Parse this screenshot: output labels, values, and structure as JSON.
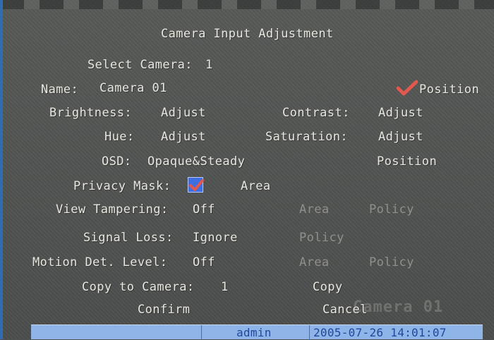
{
  "dialog": {
    "title": "Camera Input Adjustment",
    "select_camera_label": "Select Camera:",
    "select_camera_value": "1",
    "name_label": "Name:",
    "name_value": "Camera 01",
    "name_position_label": "Position",
    "brightness_label": "Brightness:",
    "brightness_action": "Adjust",
    "contrast_label": "Contrast:",
    "contrast_action": "Adjust",
    "hue_label": "Hue:",
    "hue_action": "Adjust",
    "saturation_label": "Saturation:",
    "saturation_action": "Adjust",
    "osd_label": "OSD:",
    "osd_value": "Opaque&Steady",
    "osd_position_label": "Position",
    "privacy_mask_label": "Privacy Mask:",
    "privacy_mask_checked": true,
    "privacy_area_label": "Area",
    "view_tampering_label": "View Tampering:",
    "view_tampering_value": "Off",
    "view_tampering_area": "Area",
    "view_tampering_policy": "Policy",
    "signal_loss_label": "Signal Loss:",
    "signal_loss_value": "Ignore",
    "signal_loss_policy": "Policy",
    "motion_label": "Motion Det. Level:",
    "motion_value": "Off",
    "motion_area": "Area",
    "motion_policy": "Policy",
    "copy_to_label": "Copy to Camera:",
    "copy_to_value": "1",
    "copy_button": "Copy",
    "confirm_button": "Confirm",
    "cancel_button": "Cancel"
  },
  "overlay": {
    "camera_watermark": "Camera 01"
  },
  "status_bar": {
    "user": "admin",
    "datetime": "2005-07-26 14:01:07"
  },
  "colors": {
    "background": "#4f5150",
    "text": "#e8e8e0",
    "disabled_text": "#8f8f8b",
    "checkmark": "#e0584e",
    "status_bar": "#8fb4e8",
    "status_text": "#21489a"
  },
  "icons": {
    "position_check": "checkmark-icon",
    "privacy_checkbox": "checkbox-checked-icon"
  }
}
